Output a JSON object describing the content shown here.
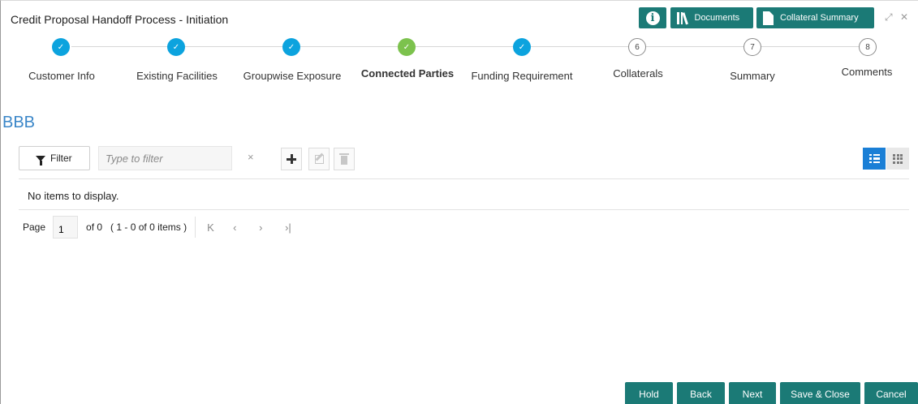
{
  "window": {
    "title": "Credit Proposal Handoff Process - Initiation",
    "info_icon_glyph": "i",
    "documents_label": "Documents",
    "collateral_summary_label": "Collateral Summary"
  },
  "stepper": {
    "steps": [
      {
        "label": "Customer Info",
        "state": "done",
        "marker": "✓"
      },
      {
        "label": "Existing Facilities",
        "state": "done",
        "marker": "✓"
      },
      {
        "label": "Groupwise Exposure",
        "state": "done",
        "marker": "✓"
      },
      {
        "label": "Connected Parties",
        "state": "active",
        "marker": "✓"
      },
      {
        "label": "Funding Requirement",
        "state": "done",
        "marker": "✓"
      },
      {
        "label": "Collaterals",
        "state": "todo",
        "marker": "6"
      },
      {
        "label": "Summary",
        "state": "todo",
        "marker": "7"
      },
      {
        "label": "Comments",
        "state": "todo",
        "marker": "8"
      }
    ]
  },
  "section": {
    "title": "BBB"
  },
  "toolbar": {
    "filter_label": "Filter",
    "filter_placeholder": "Type to filter",
    "clear_glyph": "×"
  },
  "table": {
    "empty_message": "No items to display."
  },
  "pager": {
    "page_label": "Page",
    "page_value": "1",
    "of_label": "of 0",
    "range_label": "( 1 - 0 of 0 items )",
    "first_glyph": "K",
    "prev_glyph": "‹",
    "next_glyph": "›",
    "last_glyph": "›|"
  },
  "actions": {
    "hold": "Hold",
    "back": "Back",
    "next": "Next",
    "save_close": "Save & Close",
    "cancel": "Cancel"
  },
  "colors": {
    "brand_teal": "#1b7a76",
    "step_done": "#0ca3de",
    "step_active": "#7cc24d",
    "section_title": "#3a86c8",
    "view_active": "#1a7fd6"
  },
  "icons": [
    "info-icon",
    "library-icon",
    "document-icon",
    "expand-icon",
    "close-icon",
    "check-icon",
    "filter-icon",
    "plus-icon",
    "edit-icon",
    "trash-icon",
    "list-view-icon",
    "grid-view-icon"
  ]
}
